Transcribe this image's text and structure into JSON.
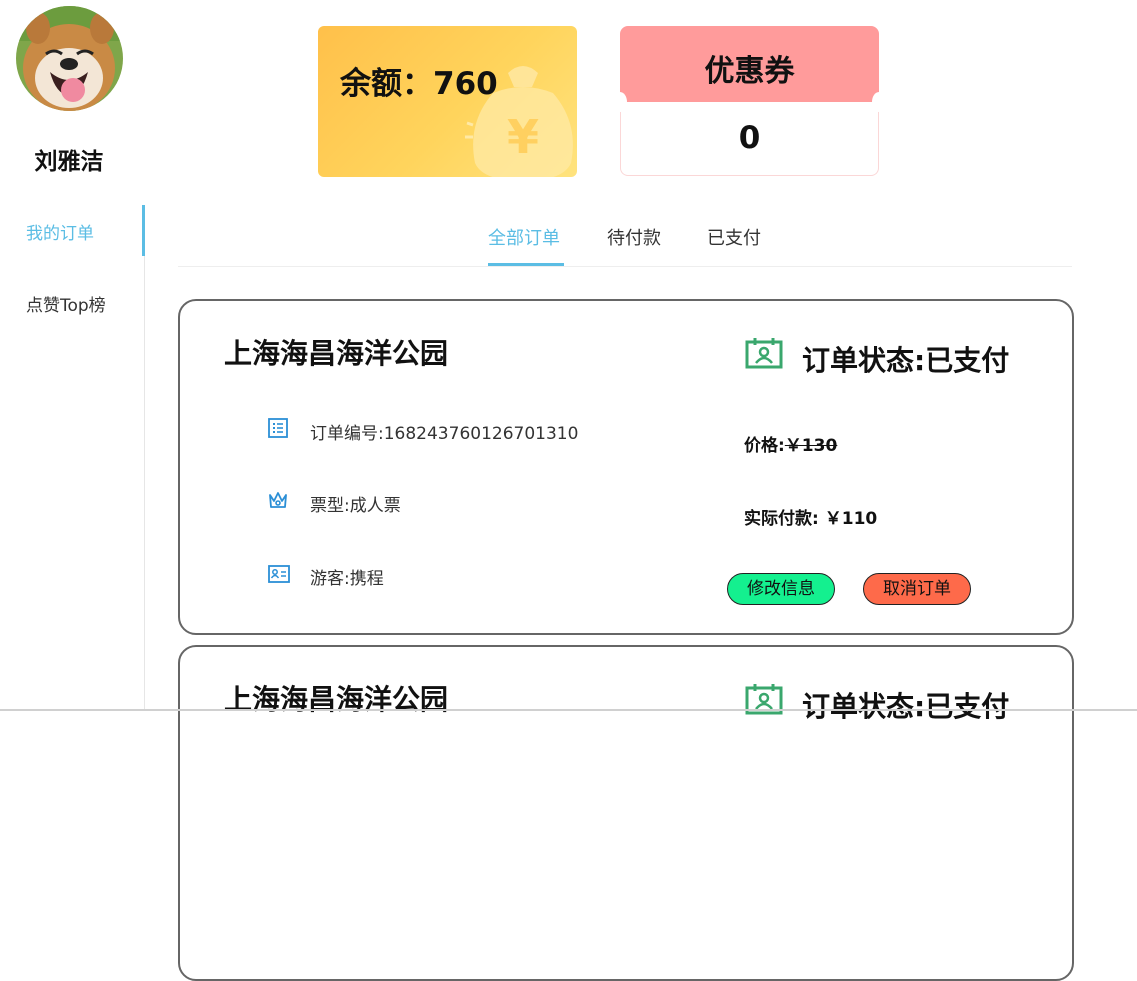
{
  "user": {
    "name": "刘雅洁"
  },
  "sidebar": {
    "items": [
      {
        "label": "我的订单",
        "active": true
      },
      {
        "label": "点赞Top榜",
        "active": false
      }
    ]
  },
  "balance": {
    "label": "余额：760"
  },
  "coupon": {
    "title": "优惠券",
    "count": "0"
  },
  "tabs": [
    {
      "label": "全部订单",
      "active": true
    },
    {
      "label": "待付款",
      "active": false
    },
    {
      "label": "已支付",
      "active": false
    }
  ],
  "orders": [
    {
      "park": "上海海昌海洋公园",
      "status": "订单状态:已支付",
      "order_no": "订单编号:168243760126701310",
      "ticket_type": "票型:成人票",
      "visitor": "游客:携程",
      "price_label": "价格:",
      "price": "￥130",
      "paid_label": "实际付款:",
      "paid": "￥110",
      "edit_button": "修改信息",
      "cancel_button": "取消订单"
    },
    {
      "park": "上海海昌海洋公园",
      "status": "订单状态:已支付"
    }
  ],
  "colors": {
    "accent": "#5bbde4",
    "balance_card": "#ffd45c",
    "coupon_header": "#ff9b9b",
    "status_icon": "#3aa76d",
    "edit_button": "#14f08f",
    "cancel_button": "#fe6a4a"
  },
  "icons": [
    "calendar-person-icon",
    "list-icon",
    "crown-icon",
    "id-card-icon",
    "money-bag-icon"
  ]
}
